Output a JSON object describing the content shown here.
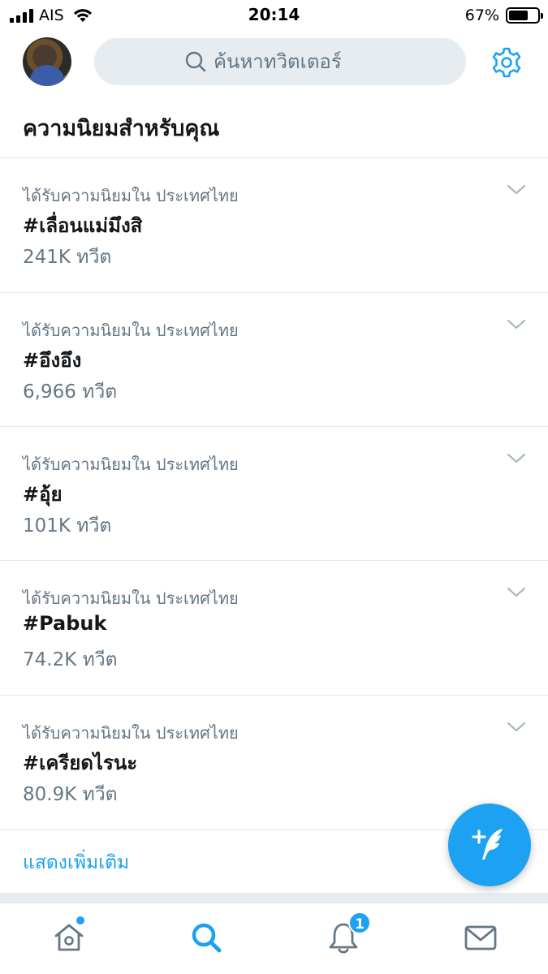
{
  "status_bar": {
    "carrier": "AIS",
    "time": "20:14",
    "battery_percent": "67%",
    "battery_level": 0.67
  },
  "header": {
    "search_placeholder": "ค้นหาทวิตเตอร์",
    "icons": {
      "avatar": "profile-avatar",
      "search": "search-icon",
      "settings": "gear-icon"
    }
  },
  "section_title": "ความนิยมสำหรับคุณ",
  "trends": [
    {
      "context": "ได้รับความนิยมใน ประเทศไทย",
      "name": "#เลื่อนแม่มึงสิ",
      "count": "241K ทวีต"
    },
    {
      "context": "ได้รับความนิยมใน ประเทศไทย",
      "name": "#อึงอึง",
      "count": "6,966 ทวีต"
    },
    {
      "context": "ได้รับความนิยมใน ประเทศไทย",
      "name": "#อุ้ย",
      "count": "101K ทวีต"
    },
    {
      "context": "ได้รับความนิยมใน ประเทศไทย",
      "name": "#Pabuk",
      "count": "74.2K ทวีต"
    },
    {
      "context": "ได้รับความนิยมใน ประเทศไทย",
      "name": "#เครียดไรนะ",
      "count": "80.9K ทวีต"
    }
  ],
  "show_more": "แสดงเพิ่มเติม",
  "tab_bar": {
    "tabs": [
      "home-icon",
      "search-icon",
      "notifications-icon",
      "messages-icon"
    ],
    "active_tab": "search-icon",
    "notification_badge": "1"
  },
  "colors": {
    "accent": "#1da1f2",
    "secondary_text": "#657786",
    "primary_text": "#14171a",
    "search_background": "#e6ecf0",
    "divider": "#e1e8ed"
  }
}
